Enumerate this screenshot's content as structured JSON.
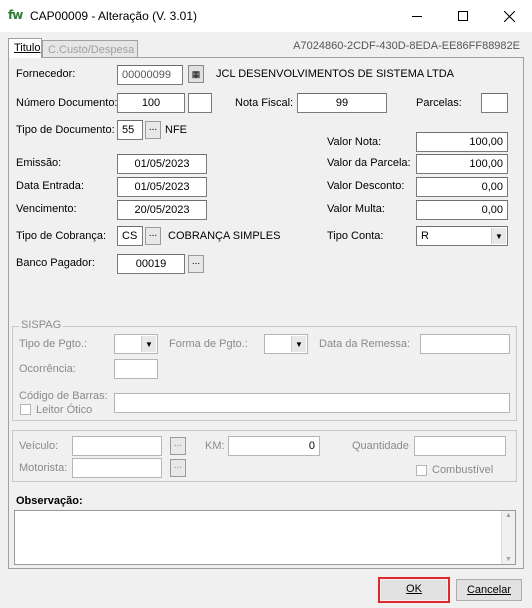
{
  "window": {
    "app_icon": "fw",
    "title": "CAP00009 - Alteração    (V. 3.01)",
    "minimize": "—",
    "maximize": "☐",
    "close": "✕"
  },
  "tabs": [
    {
      "label": "Titulo",
      "active": true
    },
    {
      "label": "C.Custo/Despesa",
      "active": false
    }
  ],
  "record_id": "A7024860-2CDF-430D-8EDA-EE86FF88982E",
  "form": {
    "fornecedor_label": "Fornecedor:",
    "fornecedor_code": "00000099",
    "fornecedor_name": "JCL DESENVOLVIMENTOS DE SISTEMA LTDA",
    "numero_documento_label": "Número Documento:",
    "numero_documento": "100",
    "numero_documento_suffix": "",
    "nota_fiscal_label": "Nota Fiscal:",
    "nota_fiscal": "99",
    "parcelas_label": "Parcelas:",
    "parcelas": "",
    "tipo_documento_label": "Tipo de Documento:",
    "tipo_documento_code": "55",
    "tipo_documento_name": "NFE",
    "emissao_label": "Emissão:",
    "emissao": "01/05/2023",
    "data_entrada_label": "Data Entrada:",
    "data_entrada": "01/05/2023",
    "vencimento_label": "Vencimento:",
    "vencimento": "20/05/2023",
    "tipo_cobranca_label": "Tipo de Cobrança:",
    "tipo_cobranca_code": "CS",
    "tipo_cobranca_name": "COBRANÇA SIMPLES",
    "banco_pagador_label": "Banco Pagador:",
    "banco_pagador": "00019",
    "valor_nota_label": "Valor Nota:",
    "valor_nota": "100,00",
    "valor_parcela_label": "Valor da Parcela:",
    "valor_parcela": "100,00",
    "valor_desconto_label": "Valor Desconto:",
    "valor_desconto": "0,00",
    "valor_multa_label": "Valor Multa:",
    "valor_multa": "0,00",
    "tipo_conta_label": "Tipo Conta:",
    "tipo_conta": "R",
    "ellipsis": "..."
  },
  "sispag": {
    "title": "SISPAG",
    "tipo_pgto_label": "Tipo de Pgto.:",
    "forma_pgto_label": "Forma de Pgto.:",
    "data_remessa_label": "Data da Remessa:",
    "ocorrencia_label": "Ocorrência:",
    "codigo_barras_label": "Código de Barras:",
    "leitor_otico_label": "Leitor Ótico"
  },
  "veiculo": {
    "veiculo_label": "Veículo:",
    "km_label": "KM:",
    "km_value": "0",
    "quantidade_label": "Quantidade",
    "motorista_label": "Motorista:",
    "combustivel_label": "Combustível"
  },
  "observacao_label": "Observação:",
  "buttons": {
    "ok": "OK",
    "cancelar": "Cancelar"
  }
}
